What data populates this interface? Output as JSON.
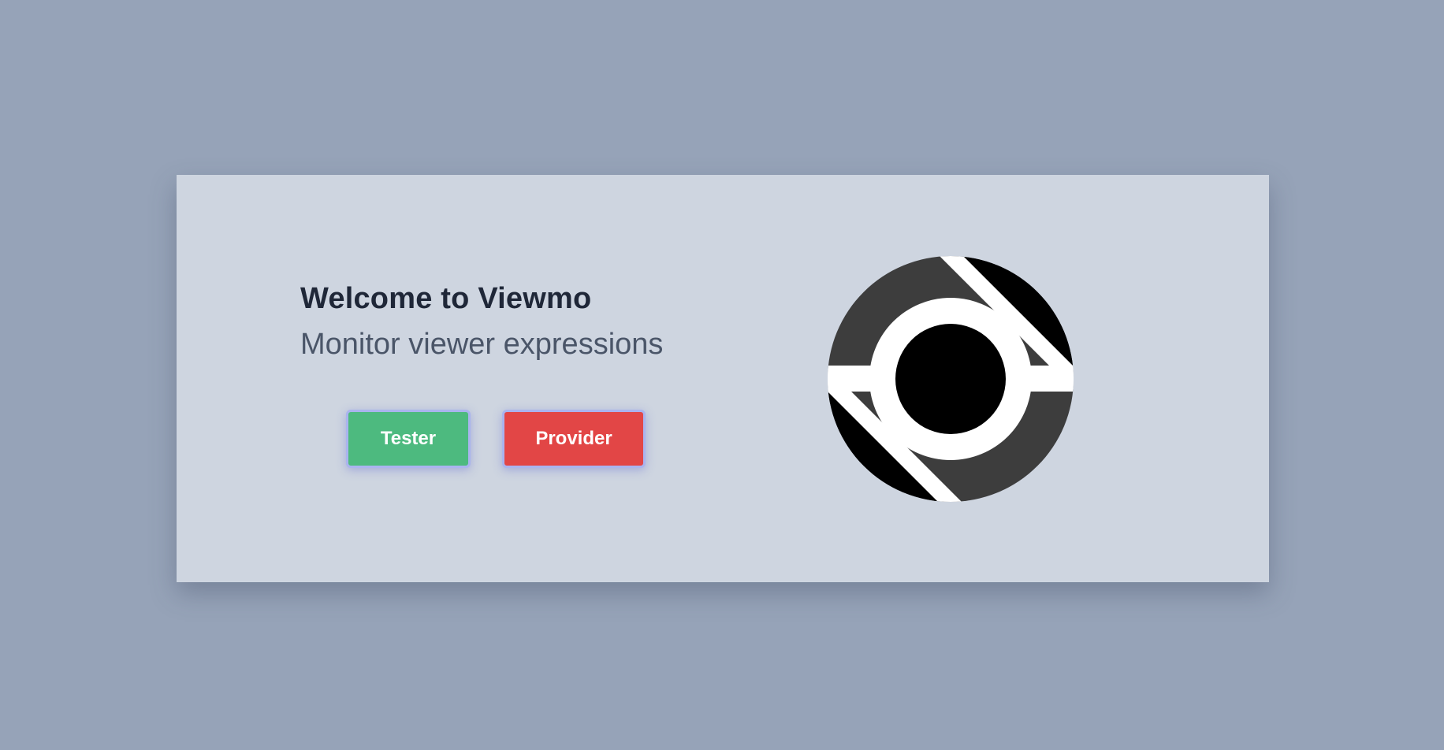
{
  "hero": {
    "title": "Welcome to Viewmo",
    "subtitle": "Monitor viewer expressions"
  },
  "buttons": {
    "tester_label": "Tester",
    "provider_label": "Provider"
  },
  "logo": {
    "icon": "viewmo-logo-icon"
  },
  "colors": {
    "background": "#96a3b8",
    "card": "#ced5e0",
    "tester": "#4dba7f",
    "provider": "#e24646",
    "title": "#1f2738",
    "subtitle": "#4a5568"
  }
}
